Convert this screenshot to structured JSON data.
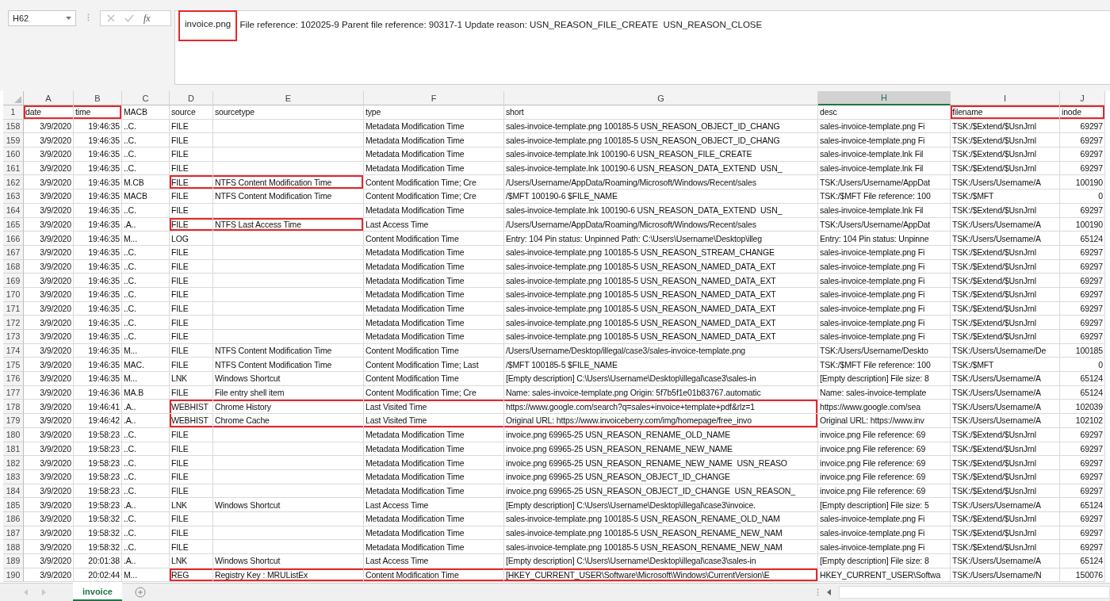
{
  "name_box": "H62",
  "function_label": "fx",
  "formula": {
    "highlighted": "invoice.png",
    "text": " File reference: 102025-9 Parent file reference: 90317-1 Update reason: USN_REASON_FILE_CREATE  USN_REASON_CLOSE"
  },
  "columns": [
    {
      "letter": "A",
      "selected": false
    },
    {
      "letter": "B",
      "selected": false
    },
    {
      "letter": "C",
      "selected": false
    },
    {
      "letter": "D",
      "selected": false
    },
    {
      "letter": "E",
      "selected": false
    },
    {
      "letter": "F",
      "selected": false
    },
    {
      "letter": "G",
      "selected": false
    },
    {
      "letter": "H",
      "selected": true
    },
    {
      "letter": "I",
      "selected": false
    },
    {
      "letter": "J",
      "selected": false
    }
  ],
  "header_row": {
    "number": "1",
    "cells": [
      "date",
      "time",
      "MACB",
      "source",
      "sourcetype",
      "type",
      "short",
      "desc",
      "filename",
      "inode"
    ],
    "boxed": [
      true,
      true,
      false,
      false,
      false,
      false,
      false,
      false,
      true,
      true
    ]
  },
  "rows": [
    {
      "number": "158",
      "cells": [
        "3/9/2020",
        "19:46:35",
        "..C.",
        "FILE",
        "",
        "Metadata Modification Time",
        "sales-invoice-template.png 100185-5 USN_REASON_OBJECT_ID_CHANG",
        "sales-invoice-template.png Fi",
        "TSK:/$Extend/$UsnJrnl",
        "69297"
      ]
    },
    {
      "number": "159",
      "cells": [
        "3/9/2020",
        "19:46:35",
        "..C.",
        "FILE",
        "",
        "Metadata Modification Time",
        "sales-invoice-template.png 100185-5 USN_REASON_OBJECT_ID_CHANG",
        "sales-invoice-template.png Fi",
        "TSK:/$Extend/$UsnJrnl",
        "69297"
      ]
    },
    {
      "number": "160",
      "cells": [
        "3/9/2020",
        "19:46:35",
        "..C.",
        "FILE",
        "",
        "Metadata Modification Time",
        "sales-invoice-template.lnk 100190-6 USN_REASON_FILE_CREATE",
        "sales-invoice-template.lnk Fil",
        "TSK:/$Extend/$UsnJrnl",
        "69297"
      ]
    },
    {
      "number": "161",
      "cells": [
        "3/9/2020",
        "19:46:35",
        "..C.",
        "FILE",
        "",
        "Metadata Modification Time",
        "sales-invoice-template.lnk 100190-6 USN_REASON_DATA_EXTEND  USN_",
        "sales-invoice-template.lnk Fil",
        "TSK:/$Extend/$UsnJrnl",
        "69297"
      ]
    },
    {
      "number": "162",
      "cells": [
        "3/9/2020",
        "19:46:35",
        "M.CB",
        "FILE",
        "NTFS Content Modification Time",
        "Content Modification Time; Cre",
        "/Users/Username/AppData/Roaming/Microsoft/Windows/Recent/sales",
        "TSK:/Users/Username/AppDat",
        "TSK:/Users/Username/A",
        "100190"
      ],
      "boxed": [
        false,
        false,
        false,
        true,
        true,
        false,
        false,
        false,
        false,
        false
      ]
    },
    {
      "number": "163",
      "cells": [
        "3/9/2020",
        "19:46:35",
        "MACB",
        "FILE",
        "NTFS Content Modification Time",
        "Content Modification Time; Cre",
        "/$MFT 100190-6 $FILE_NAME",
        "TSK:/$MFT File reference: 100",
        "TSK:/$MFT",
        "0"
      ]
    },
    {
      "number": "164",
      "cells": [
        "3/9/2020",
        "19:46:35",
        "..C.",
        "FILE",
        "",
        "Metadata Modification Time",
        "sales-invoice-template.lnk 100190-6 USN_REASON_DATA_EXTEND  USN_",
        "sales-invoice-template.lnk Fil",
        "TSK:/$Extend/$UsnJrnl",
        "69297"
      ]
    },
    {
      "number": "165",
      "cells": [
        "3/9/2020",
        "19:46:35",
        ".A..",
        "FILE",
        "NTFS Last Access Time",
        "Last Access Time",
        "/Users/Username/AppData/Roaming/Microsoft/Windows/Recent/sales",
        "TSK:/Users/Username/AppDat",
        "TSK:/Users/Username/A",
        "100190"
      ],
      "boxed": [
        false,
        false,
        false,
        true,
        true,
        false,
        false,
        false,
        false,
        false
      ]
    },
    {
      "number": "166",
      "cells": [
        "3/9/2020",
        "19:46:35",
        "M...",
        "LOG",
        "",
        "Content Modification Time",
        "Entry: 104 Pin status: Unpinned Path: C:\\Users\\Username\\Desktop\\illeg",
        "Entry: 104 Pin status: Unpinne",
        "TSK:/Users/Username/A",
        "65124"
      ]
    },
    {
      "number": "167",
      "cells": [
        "3/9/2020",
        "19:46:35",
        "..C.",
        "FILE",
        "",
        "Metadata Modification Time",
        "sales-invoice-template.png 100185-5 USN_REASON_STREAM_CHANGE",
        "sales-invoice-template.png Fi",
        "TSK:/$Extend/$UsnJrnl",
        "69297"
      ]
    },
    {
      "number": "168",
      "cells": [
        "3/9/2020",
        "19:46:35",
        "..C.",
        "FILE",
        "",
        "Metadata Modification Time",
        "sales-invoice-template.png 100185-5 USN_REASON_NAMED_DATA_EXT",
        "sales-invoice-template.png Fi",
        "TSK:/$Extend/$UsnJrnl",
        "69297"
      ]
    },
    {
      "number": "169",
      "cells": [
        "3/9/2020",
        "19:46:35",
        "..C.",
        "FILE",
        "",
        "Metadata Modification Time",
        "sales-invoice-template.png 100185-5 USN_REASON_NAMED_DATA_EXT",
        "sales-invoice-template.png Fi",
        "TSK:/$Extend/$UsnJrnl",
        "69297"
      ]
    },
    {
      "number": "170",
      "cells": [
        "3/9/2020",
        "19:46:35",
        "..C.",
        "FILE",
        "",
        "Metadata Modification Time",
        "sales-invoice-template.png 100185-5 USN_REASON_NAMED_DATA_EXT",
        "sales-invoice-template.png Fi",
        "TSK:/$Extend/$UsnJrnl",
        "69297"
      ]
    },
    {
      "number": "171",
      "cells": [
        "3/9/2020",
        "19:46:35",
        "..C.",
        "FILE",
        "",
        "Metadata Modification Time",
        "sales-invoice-template.png 100185-5 USN_REASON_NAMED_DATA_EXT",
        "sales-invoice-template.png Fi",
        "TSK:/$Extend/$UsnJrnl",
        "69297"
      ]
    },
    {
      "number": "172",
      "cells": [
        "3/9/2020",
        "19:46:35",
        "..C.",
        "FILE",
        "",
        "Metadata Modification Time",
        "sales-invoice-template.png 100185-5 USN_REASON_NAMED_DATA_EXT",
        "sales-invoice-template.png Fi",
        "TSK:/$Extend/$UsnJrnl",
        "69297"
      ]
    },
    {
      "number": "173",
      "cells": [
        "3/9/2020",
        "19:46:35",
        "..C.",
        "FILE",
        "",
        "Metadata Modification Time",
        "sales-invoice-template.png 100185-5 USN_REASON_NAMED_DATA_EXT",
        "sales-invoice-template.png Fi",
        "TSK:/$Extend/$UsnJrnl",
        "69297"
      ]
    },
    {
      "number": "174",
      "cells": [
        "3/9/2020",
        "19:46:35",
        "M...",
        "FILE",
        "NTFS Content Modification Time",
        "Content Modification Time",
        "/Users/Username/Desktop/illegal/case3/sales-invoice-template.png",
        "TSK:/Users/Username/Deskto",
        "TSK:/Users/Username/De",
        "100185"
      ]
    },
    {
      "number": "175",
      "cells": [
        "3/9/2020",
        "19:46:35",
        "MAC.",
        "FILE",
        "NTFS Content Modification Time",
        "Content Modification Time; Last",
        "/$MFT 100185-5 $FILE_NAME",
        "TSK:/$MFT File reference: 100",
        "TSK:/$MFT",
        "0"
      ]
    },
    {
      "number": "176",
      "cells": [
        "3/9/2020",
        "19:46:35",
        "M...",
        "LNK",
        "Windows Shortcut",
        "Content Modification Time",
        "[Empty description] C:\\Users\\Username\\Desktop\\illegal\\case3\\sales-in",
        "[Empty description] File size: 8",
        "TSK:/Users/Username/A",
        "65124"
      ]
    },
    {
      "number": "177",
      "cells": [
        "3/9/2020",
        "19:46:36",
        "MA.B",
        "FILE",
        "File entry shell item",
        "Content Modification Time; Cre",
        "Name: sales-invoice-template.png Origin: 5f7b5f1e01b83767.automatic",
        "Name: sales-invoice-template",
        "TSK:/Users/Username/A",
        "65124"
      ]
    },
    {
      "number": "178",
      "cells": [
        "3/9/2020",
        "19:46:41",
        ".A..",
        "WEBHIST",
        "Chrome History",
        "Last Visited Time",
        "https://www.google.com/search?q=sales+invoice+template+pdf&rlz=1",
        "https://www.google.com/sea",
        "TSK:/Users/Username/A",
        "102039"
      ],
      "boxed": [
        false,
        false,
        false,
        true,
        true,
        true,
        true,
        false,
        false,
        false
      ]
    },
    {
      "number": "179",
      "cells": [
        "3/9/2020",
        "19:46:42",
        ".A..",
        "WEBHIST",
        "Chrome Cache",
        "Last Visited Time",
        "Original URL: https://www.invoiceberry.com/img/homepage/free_invo",
        "Original URL: https://www.inv",
        "TSK:/Users/Username/A",
        "102102"
      ],
      "boxed": [
        false,
        false,
        false,
        true,
        true,
        true,
        true,
        false,
        false,
        false
      ]
    },
    {
      "number": "180",
      "cells": [
        "3/9/2020",
        "19:58:23",
        "..C.",
        "FILE",
        "",
        "Metadata Modification Time",
        "invoice.png 69965-25 USN_REASON_RENAME_OLD_NAME",
        "invoice.png File reference: 69",
        "TSK:/$Extend/$UsnJrnl",
        "69297"
      ]
    },
    {
      "number": "181",
      "cells": [
        "3/9/2020",
        "19:58:23",
        "..C.",
        "FILE",
        "",
        "Metadata Modification Time",
        "invoice.png 69965-25 USN_REASON_RENAME_NEW_NAME",
        "invoice.png File reference: 69",
        "TSK:/$Extend/$UsnJrnl",
        "69297"
      ]
    },
    {
      "number": "182",
      "cells": [
        "3/9/2020",
        "19:58:23",
        "..C.",
        "FILE",
        "",
        "Metadata Modification Time",
        "invoice.png 69965-25 USN_REASON_RENAME_NEW_NAME  USN_REASO",
        "invoice.png File reference: 69",
        "TSK:/$Extend/$UsnJrnl",
        "69297"
      ]
    },
    {
      "number": "183",
      "cells": [
        "3/9/2020",
        "19:58:23",
        "..C.",
        "FILE",
        "",
        "Metadata Modification Time",
        "invoice.png 69965-25 USN_REASON_OBJECT_ID_CHANGE",
        "invoice.png File reference: 69",
        "TSK:/$Extend/$UsnJrnl",
        "69297"
      ]
    },
    {
      "number": "184",
      "cells": [
        "3/9/2020",
        "19:58:23",
        "..C.",
        "FILE",
        "",
        "Metadata Modification Time",
        "invoice.png 69965-25 USN_REASON_OBJECT_ID_CHANGE  USN_REASON_",
        "invoice.png File reference: 69",
        "TSK:/$Extend/$UsnJrnl",
        "69297"
      ]
    },
    {
      "number": "185",
      "cells": [
        "3/9/2020",
        "19:58:23",
        ".A..",
        "LNK",
        "Windows Shortcut",
        "Last Access Time",
        "[Empty description] C:\\Users\\Username\\Desktop\\illegal\\case3\\invoice.",
        "[Empty description] File size: 5",
        "TSK:/Users/Username/A",
        "65124"
      ]
    },
    {
      "number": "186",
      "cells": [
        "3/9/2020",
        "19:58:32",
        "..C.",
        "FILE",
        "",
        "Metadata Modification Time",
        "sales-invoice-template.png 100185-5 USN_REASON_RENAME_OLD_NAM",
        "sales-invoice-template.png Fi",
        "TSK:/$Extend/$UsnJrnl",
        "69297"
      ]
    },
    {
      "number": "187",
      "cells": [
        "3/9/2020",
        "19:58:32",
        "..C.",
        "FILE",
        "",
        "Metadata Modification Time",
        "sales-invoice-template.png 100185-5 USN_REASON_RENAME_NEW_NAM",
        "sales-invoice-template.png Fi",
        "TSK:/$Extend/$UsnJrnl",
        "69297"
      ]
    },
    {
      "number": "188",
      "cells": [
        "3/9/2020",
        "19:58:32",
        "..C.",
        "FILE",
        "",
        "Metadata Modification Time",
        "sales-invoice-template.png 100185-5 USN_REASON_RENAME_NEW_NAM",
        "sales-invoice-template.png Fi",
        "TSK:/$Extend/$UsnJrnl",
        "69297"
      ]
    },
    {
      "number": "189",
      "cells": [
        "3/9/2020",
        "20:01:38",
        ".A..",
        "LNK",
        "Windows Shortcut",
        "Last Access Time",
        "[Empty description] C:\\Users\\Username\\Desktop\\illegal\\case3\\sales-in",
        "[Empty description] File size: 8",
        "TSK:/Users/Username/A",
        "65124"
      ]
    },
    {
      "number": "190",
      "cells": [
        "3/9/2020",
        "20:02:44",
        "M...",
        "REG",
        "Registry Key : MRUListEx",
        "Content Modification Time",
        "[HKEY_CURRENT_USER\\Software\\Microsoft\\Windows\\CurrentVersion\\E",
        "HKEY_CURRENT_USER\\Softwa",
        "TSK:/Users/Username/N",
        "150076"
      ],
      "boxed": [
        false,
        false,
        false,
        true,
        true,
        true,
        true,
        false,
        false,
        false
      ]
    }
  ],
  "sheet_tabs": [
    {
      "label": "invoice",
      "selected": true
    }
  ]
}
